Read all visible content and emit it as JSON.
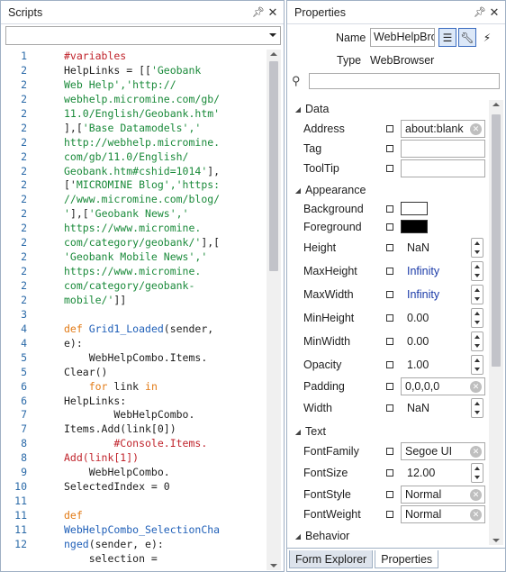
{
  "scripts": {
    "title": "Scripts",
    "line_numbers": [
      "1",
      "2",
      "2",
      "2",
      "2",
      "2",
      "2",
      "2",
      "2",
      "2",
      "2",
      "2",
      "2",
      "2",
      "2",
      "2",
      "2",
      "2",
      "3",
      "4",
      "4",
      "5",
      "5",
      "6",
      "6",
      "7",
      "7",
      "8",
      "8",
      "9",
      "10",
      "11",
      "11",
      "11",
      "12"
    ],
    "code": [
      [
        {
          "t": "#variables",
          "c": "c"
        }
      ],
      [
        {
          "t": "HelpLinks = [[",
          "c": ""
        },
        {
          "t": "'Geobank",
          "c": "s"
        }
      ],
      [
        {
          "t": "Web Help','http://",
          "c": "s"
        }
      ],
      [
        {
          "t": "webhelp.micromine.com/gb/",
          "c": "s"
        }
      ],
      [
        {
          "t": "11.0/English/Geobank.htm'",
          "c": "s"
        }
      ],
      [
        {
          "t": "],[",
          "c": ""
        },
        {
          "t": "'Base Datamodels','",
          "c": "s"
        }
      ],
      [
        {
          "t": "http://webhelp.micromine.",
          "c": "s"
        }
      ],
      [
        {
          "t": "com/gb/11.0/English/",
          "c": "s"
        }
      ],
      [
        {
          "t": "Geobank.htm#cshid=1014'",
          "c": "s"
        },
        {
          "t": "],",
          "c": ""
        }
      ],
      [
        {
          "t": "['",
          "c": ""
        },
        {
          "t": "MICROMINE Blog','https:",
          "c": "s"
        }
      ],
      [
        {
          "t": "//www.micromine.com/blog/",
          "c": "s"
        }
      ],
      [
        {
          "t": "'",
          "c": "s"
        },
        {
          "t": "],[",
          "c": ""
        },
        {
          "t": "'Geobank News','",
          "c": "s"
        }
      ],
      [
        {
          "t": "https://www.micromine.",
          "c": "s"
        }
      ],
      [
        {
          "t": "com/category/geobank/'",
          "c": "s"
        },
        {
          "t": "],[",
          "c": ""
        }
      ],
      [
        {
          "t": "'Geobank Mobile News','",
          "c": "s"
        }
      ],
      [
        {
          "t": "https://www.micromine.",
          "c": "s"
        }
      ],
      [
        {
          "t": "com/category/geobank-",
          "c": "s"
        }
      ],
      [
        {
          "t": "mobile/'",
          "c": "s"
        },
        {
          "t": "]]",
          "c": ""
        }
      ],
      [
        {
          "t": "",
          "c": ""
        }
      ],
      [
        {
          "t": "def ",
          "c": "k"
        },
        {
          "t": "Grid1_Loaded",
          "c": "f"
        },
        {
          "t": "(sender,",
          "c": ""
        }
      ],
      [
        {
          "t": "e):",
          "c": ""
        }
      ],
      [
        {
          "t": "    WebHelpCombo.Items.",
          "c": ""
        }
      ],
      [
        {
          "t": "Clear()",
          "c": ""
        }
      ],
      [
        {
          "t": "    ",
          "c": ""
        },
        {
          "t": "for",
          "c": "k"
        },
        {
          "t": " link ",
          "c": ""
        },
        {
          "t": "in",
          "c": "k"
        }
      ],
      [
        {
          "t": "HelpLinks:",
          "c": ""
        }
      ],
      [
        {
          "t": "        WebHelpCombo.",
          "c": ""
        }
      ],
      [
        {
          "t": "Items.Add(link[0])",
          "c": ""
        }
      ],
      [
        {
          "t": "        #Console.Items.",
          "c": "c"
        }
      ],
      [
        {
          "t": "Add(link[1])",
          "c": "c"
        }
      ],
      [
        {
          "t": "    WebHelpCombo.",
          "c": ""
        }
      ],
      [
        {
          "t": "SelectedIndex = 0",
          "c": ""
        }
      ],
      [
        {
          "t": "",
          "c": ""
        }
      ],
      [
        {
          "t": "def",
          "c": "k"
        }
      ],
      [
        {
          "t": "WebHelpCombo_SelectionCha",
          "c": "f"
        }
      ],
      [
        {
          "t": "nged",
          "c": "f"
        },
        {
          "t": "(sender, e):",
          "c": ""
        }
      ],
      [
        {
          "t": "    selection =",
          "c": ""
        }
      ]
    ]
  },
  "properties": {
    "title": "Properties",
    "name_label": "Name",
    "name_value": "WebHelpBro",
    "type_label": "Type",
    "type_value": "WebBrowser",
    "categories": {
      "data": "Data",
      "appearance": "Appearance",
      "text": "Text",
      "behavior": "Behavior"
    },
    "rows": {
      "address": {
        "name": "Address",
        "value": "about:blank"
      },
      "tag": {
        "name": "Tag",
        "value": ""
      },
      "tooltip": {
        "name": "ToolTip",
        "value": ""
      },
      "background": {
        "name": "Background",
        "color": "#ffffff"
      },
      "foreground": {
        "name": "Foreground",
        "color": "#000000"
      },
      "height": {
        "name": "Height",
        "value": "NaN"
      },
      "maxheight": {
        "name": "MaxHeight",
        "value": "Infinity"
      },
      "maxwidth": {
        "name": "MaxWidth",
        "value": "Infinity"
      },
      "minheight": {
        "name": "MinHeight",
        "value": "0.00"
      },
      "minwidth": {
        "name": "MinWidth",
        "value": "0.00"
      },
      "opacity": {
        "name": "Opacity",
        "value": "1.00"
      },
      "padding": {
        "name": "Padding",
        "value": "0,0,0,0"
      },
      "width": {
        "name": "Width",
        "value": "NaN"
      },
      "fontfamily": {
        "name": "FontFamily",
        "value": "Segoe UI"
      },
      "fontsize": {
        "name": "FontSize",
        "value": "12.00"
      },
      "fontstyle": {
        "name": "FontStyle",
        "value": "Normal"
      },
      "fontweight": {
        "name": "FontWeight",
        "value": "Normal"
      }
    },
    "tabs": {
      "form_explorer": "Form Explorer",
      "properties": "Properties"
    }
  }
}
